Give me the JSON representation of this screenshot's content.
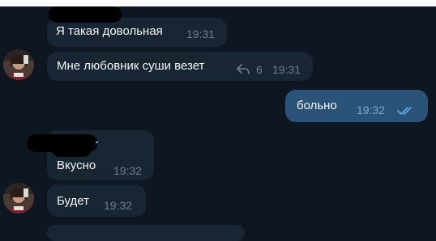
{
  "chat": {
    "messages": [
      {
        "text": "Я такая довольная",
        "time": "19:31"
      },
      {
        "text": "Мне любовник суши везет",
        "time": "19:31",
        "replies": "6"
      },
      {
        "text": "больно",
        "time": "19:32",
        "outgoing": true,
        "read": true
      },
      {
        "text": "Вкусно",
        "time": "19:32"
      },
      {
        "text": "Будет",
        "time": "19:32"
      }
    ]
  },
  "icons": {
    "reply": "reply-arrow-icon",
    "read": "double-check-icon",
    "avatar": "user-photo"
  },
  "colors": {
    "background": "#0e1621",
    "incoming_bubble": "#182533",
    "outgoing_bubble": "#2b5278",
    "time_text": "#6d7f8f",
    "outgoing_time_text": "#7da8d3",
    "check_mark": "#5fa8e8"
  }
}
